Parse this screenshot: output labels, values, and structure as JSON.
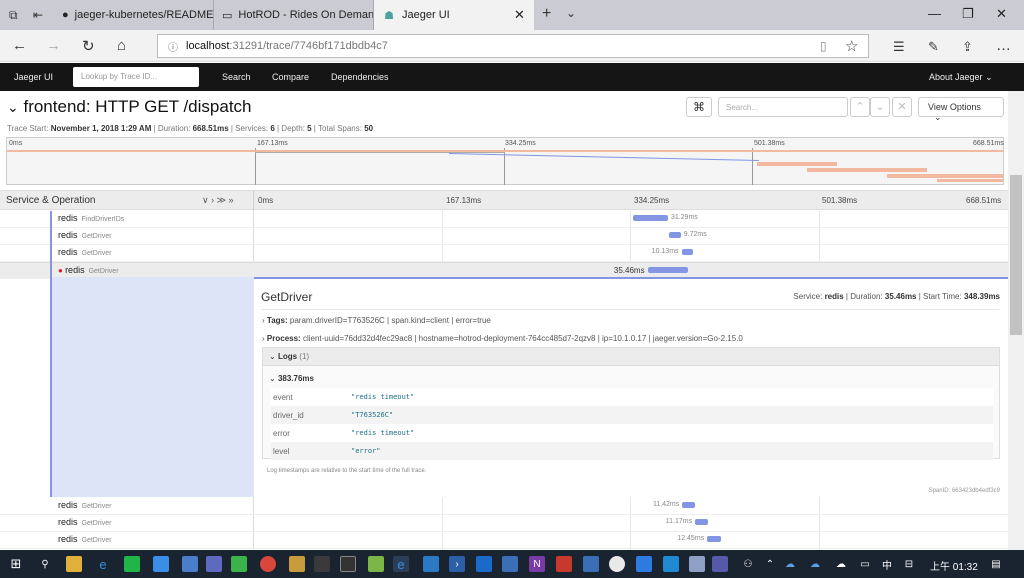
{
  "browser": {
    "tabs": [
      {
        "label": "jaeger-kubernetes/README",
        "icon": "github-icon"
      },
      {
        "label": "HotROD - Rides On Deman",
        "icon": "page-icon"
      },
      {
        "label": "Jaeger UI",
        "icon": "jaeger-icon",
        "active": true
      }
    ],
    "url_host": "localhost",
    "url_path": ":31291/trace/7746bf171dbdb4c7"
  },
  "nav": {
    "brand": "Jaeger UI",
    "lookup_placeholder": "Lookup by Trace ID...",
    "search": "Search",
    "compare": "Compare",
    "dependencies": "Dependencies",
    "about": "About Jaeger"
  },
  "trace": {
    "title": "frontend: HTTP GET /dispatch",
    "search_placeholder": "Search...",
    "view_options": "View Options",
    "start_label": "Trace Start:",
    "start_value": "November 1, 2018 1:29 AM",
    "duration_label": "Duration:",
    "duration_value": "668.51ms",
    "services_label": "Services:",
    "services_value": "6",
    "depth_label": "Depth:",
    "depth_value": "5",
    "spans_label": "Total Spans:",
    "spans_value": "50"
  },
  "minimap_ticks": [
    "0ms",
    "167.13ms",
    "334.25ms",
    "501.38ms",
    "668.51ms"
  ],
  "table": {
    "header": "Service & Operation",
    "ticks": [
      "0ms",
      "167.13ms",
      "334.25ms",
      "501.38ms",
      "668.51ms"
    ]
  },
  "rows_top": [
    {
      "service": "redis",
      "op": "FindDriverIDs",
      "label": "31.29ms",
      "start": 0.502,
      "dur": 0.047
    },
    {
      "service": "redis",
      "op": "GetDriver",
      "label": "9.72ms",
      "start": 0.551,
      "dur": 0.015
    },
    {
      "service": "redis",
      "op": "GetDriver",
      "label": "10.13ms",
      "start": 0.567,
      "dur": 0.015
    },
    {
      "service": "redis",
      "op": "GetDriver",
      "label": "35.46ms",
      "start": 0.522,
      "dur": 0.053,
      "error": true
    }
  ],
  "detail": {
    "title": "GetDriver",
    "service_label": "Service:",
    "service_value": "redis",
    "duration_label": "Duration:",
    "duration_value": "35.46ms",
    "start_label": "Start Time:",
    "start_value": "348.39ms",
    "tags_label": "Tags:",
    "tags": [
      {
        "key": "param.driverID",
        "value": "T763526C"
      },
      {
        "key": "span.kind",
        "value": "client"
      },
      {
        "key": "error",
        "value": "true"
      }
    ],
    "process_label": "Process:",
    "process": [
      {
        "key": "client-uuid",
        "value": "76dd32d4fec29ac8"
      },
      {
        "key": "hostname",
        "value": "hotrod-deployment-764cc485d7-2qzv8"
      },
      {
        "key": "ip",
        "value": "10.1.0.17"
      },
      {
        "key": "jaeger.version",
        "value": "Go-2.15.0"
      }
    ],
    "logs_label": "Logs",
    "logs_count": "(1)",
    "log_time": "383.76ms",
    "log_fields": [
      {
        "key": "event",
        "value": "\"redis timeout\""
      },
      {
        "key": "driver_id",
        "value": "\"T763526C\""
      },
      {
        "key": "error",
        "value": "\"redis timeout\""
      },
      {
        "key": "level",
        "value": "\"error\""
      }
    ],
    "log_note": "Log timestamps are relative to the start time of the full trace.",
    "span_id_label": "SpanID:",
    "span_id": "663423db4edf3c9"
  },
  "rows_bottom": [
    {
      "service": "redis",
      "op": "GetDriver",
      "label": "11.42ms",
      "start": 0.568,
      "dur": 0.017
    },
    {
      "service": "redis",
      "op": "GetDriver",
      "label": "11.17ms",
      "start": 0.585,
      "dur": 0.017
    },
    {
      "service": "redis",
      "op": "GetDriver",
      "label": "12.45ms",
      "start": 0.601,
      "dur": 0.019
    }
  ],
  "taskbar": {
    "time": "上午 01:32",
    "ime": "中"
  },
  "colors": {
    "span": "#8395e3",
    "error": "#e02020",
    "nav": "#151515"
  }
}
